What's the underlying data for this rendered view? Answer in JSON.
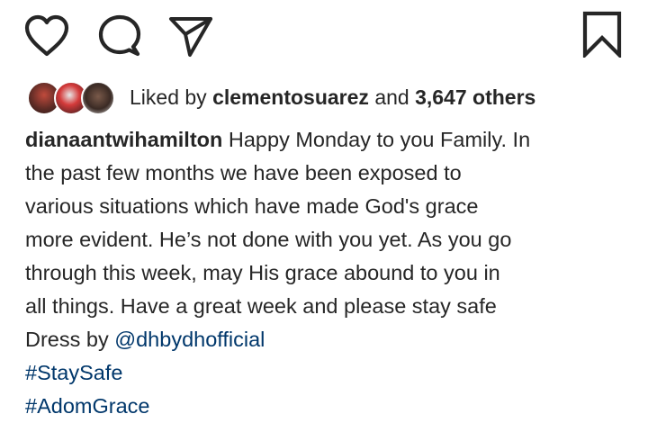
{
  "actions": {
    "like_icon": "heart-icon",
    "comment_icon": "comment-bubble-icon",
    "share_icon": "paper-plane-icon",
    "save_icon": "bookmark-icon"
  },
  "likes": {
    "prefix": "Liked by",
    "user": "clementosuarez",
    "conjunction": "and",
    "count": "3,647 others"
  },
  "caption": {
    "username": "dianaantwihamilton",
    "lines": [
      "Happy Monday to you Family.  In",
      "the past few months we have been exposed to",
      "various situations which have made God's grace",
      "more evident. He’s not done with you yet. As you go",
      "through this week, may His grace abound to you  in",
      "all things. Have a great week and please stay safe"
    ],
    "dress_prefix": "Dress by",
    "dress_mention": "@dhbydhofficial",
    "hashtags": [
      "#StaySafe",
      "#AdomGrace"
    ]
  },
  "colors": {
    "text": "#262626",
    "link": "#00376b",
    "background": "#ffffff"
  }
}
